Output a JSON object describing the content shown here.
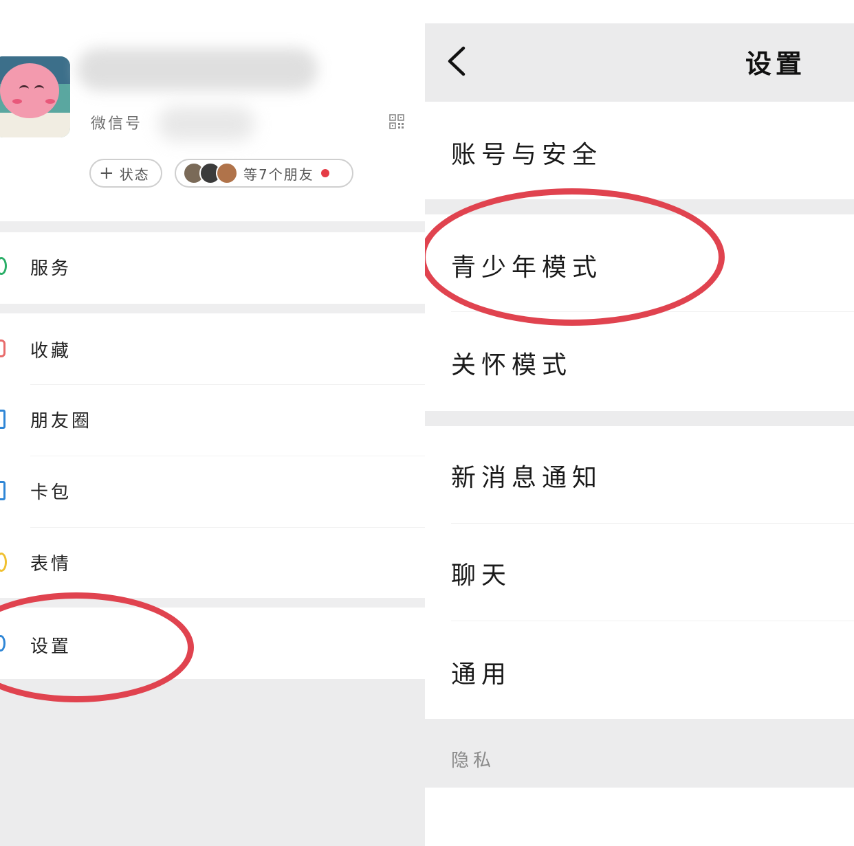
{
  "left_panel": {
    "wechat_id_label": "微信号",
    "status_button": {
      "icon": "plus-icon",
      "label": "状态"
    },
    "friends_button": {
      "label": "等7个朋友"
    },
    "menu": [
      {
        "label": "服务",
        "icon": "service-icon",
        "color": "#2aae67"
      },
      {
        "label": "收藏",
        "icon": "favorites-icon",
        "color": "#e86b6b"
      },
      {
        "label": "朋友圈",
        "icon": "moments-icon",
        "color": "#2f86d6"
      },
      {
        "label": "卡包",
        "icon": "cards-icon",
        "color": "#2f86d6"
      },
      {
        "label": "表情",
        "icon": "sticker-icon",
        "color": "#f0c030"
      },
      {
        "label": "设置",
        "icon": "settings-icon",
        "color": "#2f86d6"
      }
    ]
  },
  "right_panel": {
    "title": "设置",
    "items": [
      {
        "label": "账号与安全"
      },
      {
        "label": "青少年模式"
      },
      {
        "label": "关怀模式"
      },
      {
        "label": "新消息通知"
      },
      {
        "label": "聊天"
      },
      {
        "label": "通用"
      }
    ],
    "section_header": "隐私"
  },
  "highlight_color": "#e0434f",
  "unread_dot_color": "#e53c46"
}
